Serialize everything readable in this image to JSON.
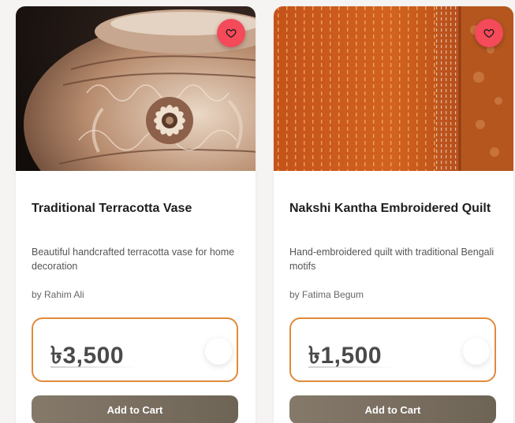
{
  "colors": {
    "accent_orange": "#e08a3c",
    "favorite_red": "#f44a5a",
    "button_brown": "#7a6f60"
  },
  "products": [
    {
      "image_icon": "terracotta-vase-image",
      "favorite_icon": "heart-icon",
      "title": "Traditional Terracotta Vase",
      "description": "Beautiful handcrafted terracotta vase for home decoration",
      "artisan": "by Rahim Ali",
      "price": "৳3,500",
      "cart_label": "Add to Cart"
    },
    {
      "image_icon": "nakshi-kantha-quilt-image",
      "favorite_icon": "heart-icon",
      "title": "Nakshi Kantha Embroidered Quilt",
      "description": "Hand-embroidered quilt with traditional Bengali motifs",
      "artisan": "by Fatima Begum",
      "price": "৳1,500",
      "cart_label": "Add to Cart"
    }
  ]
}
